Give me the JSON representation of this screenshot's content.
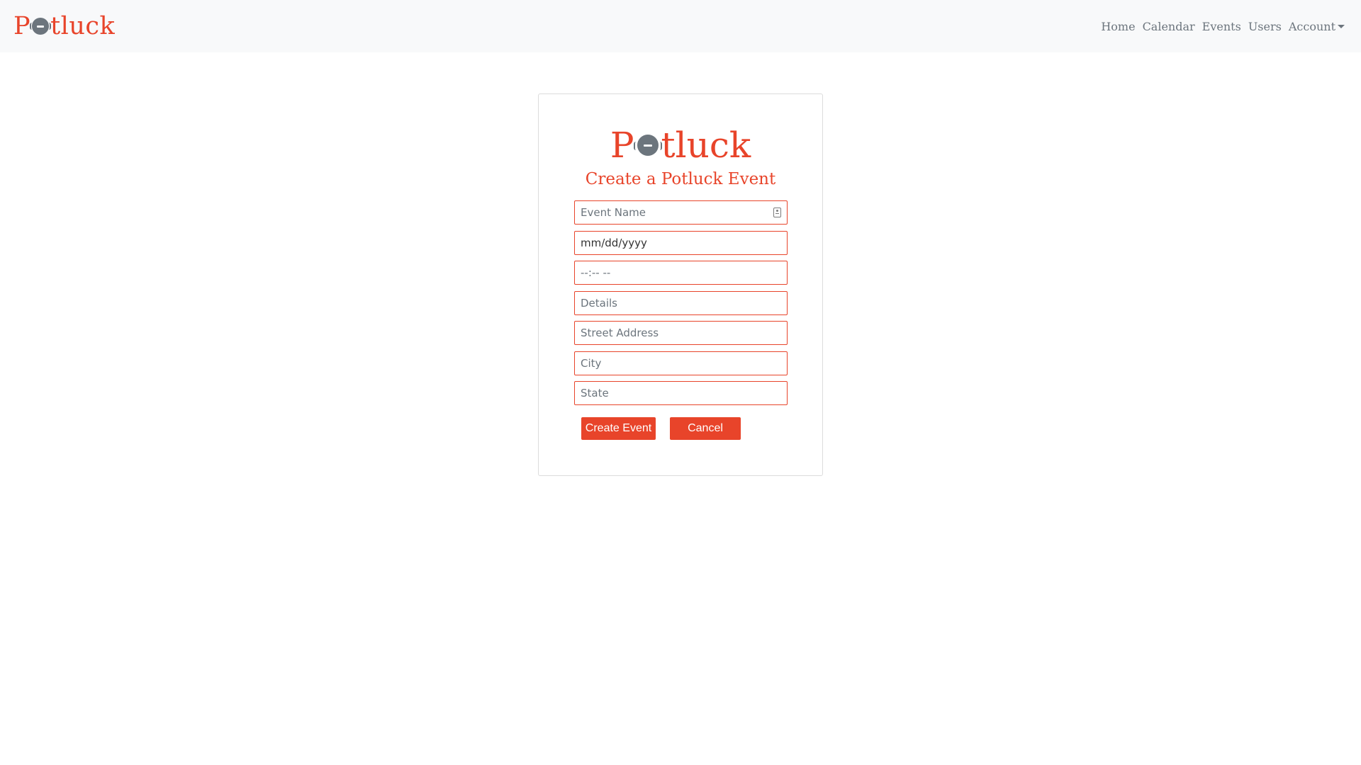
{
  "navbar": {
    "brand": {
      "before": "P",
      "after": "tluck"
    },
    "links": [
      "Home",
      "Calendar",
      "Events",
      "Users"
    ],
    "account_label": "Account"
  },
  "card": {
    "logo": {
      "before": "P",
      "after": "tluck"
    },
    "title": "Create a Potluck Event",
    "fields": {
      "event_name": {
        "placeholder": "Event Name",
        "value": ""
      },
      "date": {
        "display": "mm/dd/yyyy"
      },
      "time": {
        "display": "--:-- --"
      },
      "details": {
        "placeholder": "Details",
        "value": ""
      },
      "street": {
        "placeholder": "Street Address",
        "value": ""
      },
      "city": {
        "placeholder": "City",
        "value": ""
      },
      "state": {
        "placeholder": "State",
        "value": ""
      }
    },
    "buttons": {
      "create": "Create Event",
      "cancel": "Cancel"
    }
  },
  "colors": {
    "brand": "#e8442a",
    "navbar_bg": "#f8f9fa",
    "nav_text": "#6c757d",
    "pot_icon": "#6c757d"
  },
  "icons": [
    "pot-icon",
    "autofill-contact-icon",
    "caret-down-icon"
  ]
}
